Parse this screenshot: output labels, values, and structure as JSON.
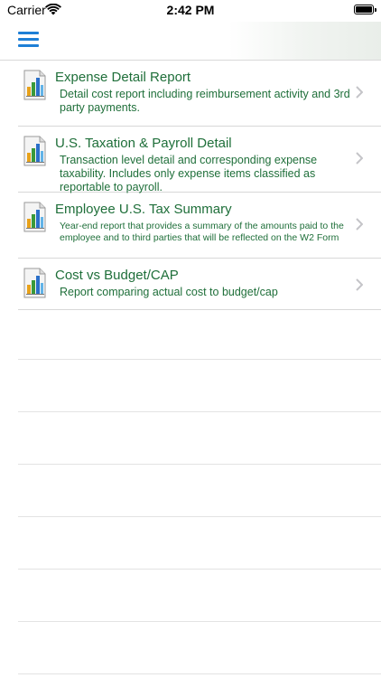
{
  "status_bar": {
    "carrier": "Carrier",
    "time": "2:42 PM"
  },
  "nav": {
    "menu_icon": "hamburger-menu-icon",
    "accent_color": "#1e7fd6"
  },
  "theme": {
    "text_color": "#1f6f3a",
    "separator_color": "#d8d8d8"
  },
  "reports": [
    {
      "icon": "report-chart-icon",
      "title": "Expense Detail Report",
      "description": "Detail cost report including reimbursement activity and 3rd party payments."
    },
    {
      "icon": "report-chart-icon",
      "title": "U.S. Taxation & Payroll Detail",
      "description": "Transaction level detail and corresponding expense taxability. Includes only expense items classified as reportable to payroll."
    },
    {
      "icon": "report-chart-icon",
      "title": "Employee U.S. Tax Summary",
      "description": "Year-end report that provides a summary of the amounts paid to the employee and to third parties that will be reflected on the W2 Form"
    },
    {
      "icon": "report-chart-icon",
      "title": "Cost vs Budget/CAP",
      "description": "Report comparing actual cost to budget/cap"
    }
  ]
}
